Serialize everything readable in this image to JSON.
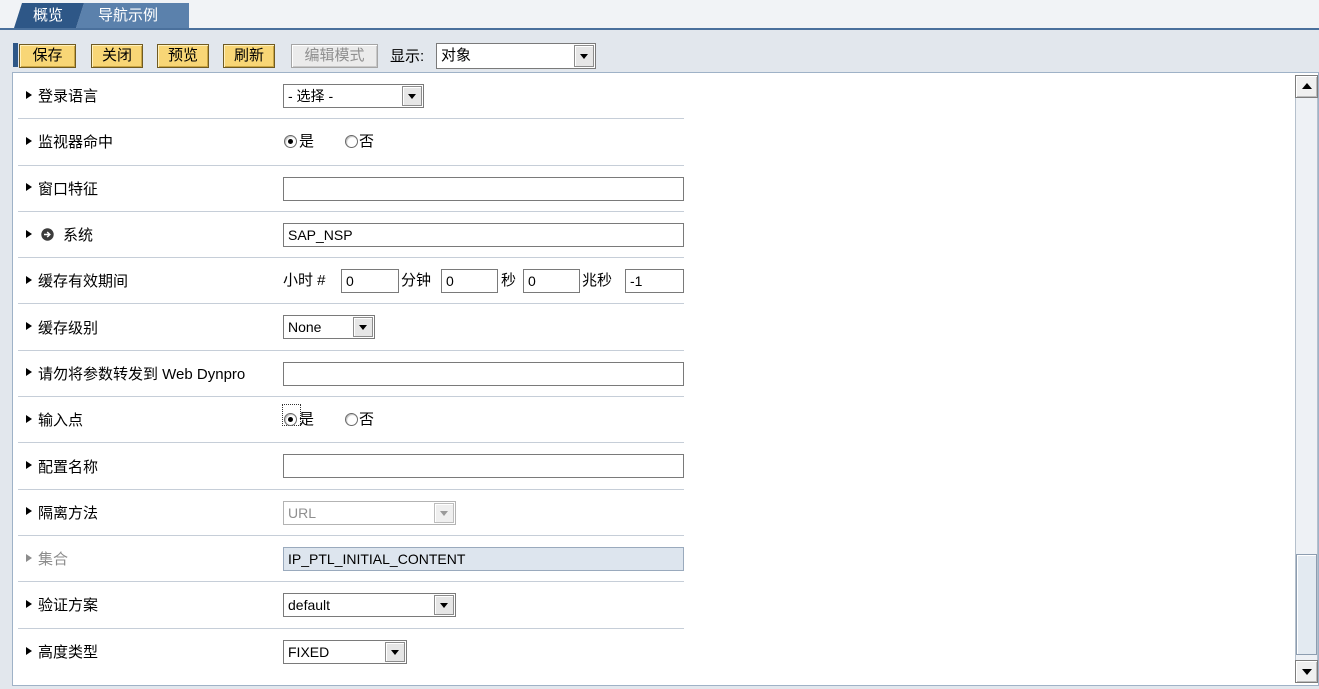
{
  "colors": {
    "tab_active": "#2e5787",
    "tab_inactive": "#5b81ac",
    "accent": "#4a709c",
    "emphasized_button": "#f8d676"
  },
  "tabs": [
    {
      "label": "概览",
      "active": true
    },
    {
      "label": "导航示例",
      "active": false
    }
  ],
  "toolbar": {
    "buttons": [
      {
        "label": "保存",
        "disabled": false
      },
      {
        "label": "关闭",
        "disabled": false
      },
      {
        "label": "预览",
        "disabled": false
      },
      {
        "label": "刷新",
        "disabled": false
      },
      {
        "label": "编辑模式",
        "disabled": true
      }
    ],
    "display_label": "显示:",
    "display_value": "对象"
  },
  "properties": [
    {
      "label": "登录语言",
      "value": "- 选择 -"
    },
    {
      "label": "监视器命中",
      "options": [
        "是",
        "否"
      ],
      "selected": 0
    },
    {
      "label": "窗口特征",
      "value": ""
    },
    {
      "label": "系统",
      "icon": "circle-arrow-icon",
      "value": "SAP_NSP"
    },
    {
      "label": "缓存有效期间",
      "fields": [
        {
          "unit": "小时 #",
          "value": "0"
        },
        {
          "unit": "分钟",
          "value": "0"
        },
        {
          "unit": "秒",
          "value": "0"
        },
        {
          "unit": "兆秒",
          "value": "-1"
        }
      ]
    },
    {
      "label": "缓存级别",
      "value": "None"
    },
    {
      "label": "请勿将参数转发到 Web Dynpro",
      "value": ""
    },
    {
      "label": "输入点",
      "options": [
        "是",
        "否"
      ],
      "selected": 0,
      "focused": true
    },
    {
      "label": "配置名称",
      "value": ""
    },
    {
      "label": "隔离方法",
      "value": "URL",
      "disabled": true
    },
    {
      "label": "集合",
      "value": "IP_PTL_INITIAL_CONTENT",
      "readonly": true
    },
    {
      "label": "验证方案",
      "value": "default"
    },
    {
      "label": "高度类型",
      "value": "FIXED"
    }
  ],
  "scrollbar": {
    "position": 0.99,
    "thumb_fraction": 0.18
  }
}
